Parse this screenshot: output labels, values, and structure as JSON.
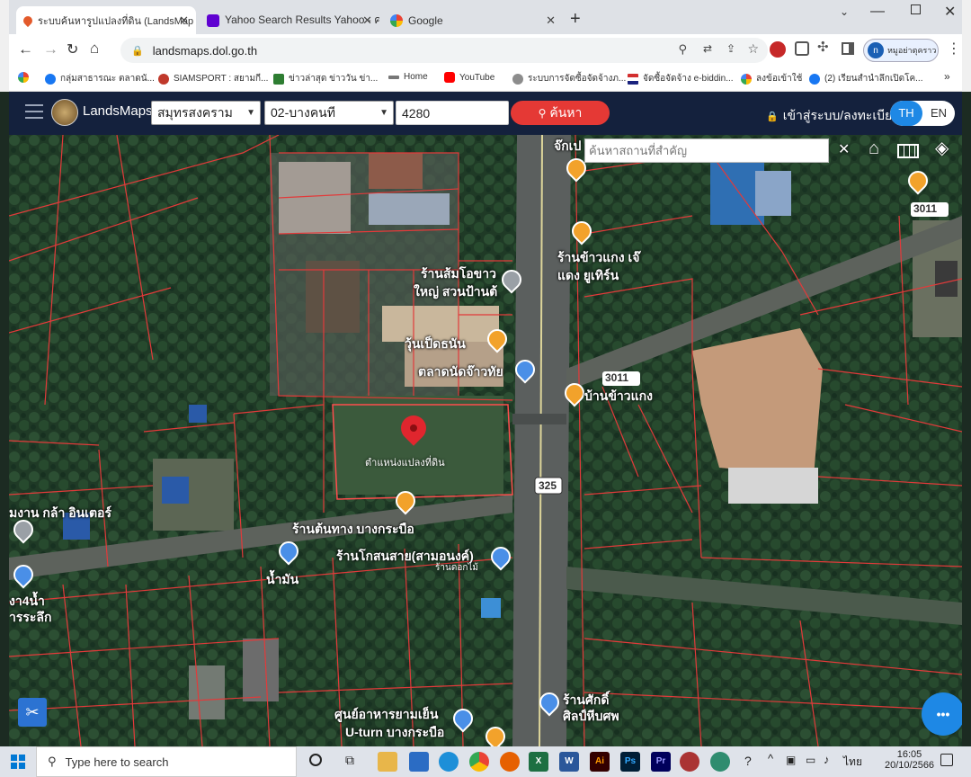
{
  "browser": {
    "tabs": [
      {
        "title": "ระบบค้นหารูปแปลงที่ดิน (LandsMap",
        "active": true
      },
      {
        "title": "Yahoo Search Results Yahoo - ค",
        "active": false
      },
      {
        "title": "Google",
        "active": false
      }
    ],
    "new_tab": "+",
    "url": "landsmaps.dol.go.th",
    "profile": "หมูอย่าตุคราว",
    "bookmarks": [
      "กลุ่มสาธารณะ ตลาดนั...",
      "SIAMSPORT : สยามกี...",
      "ข่าวล่าสุด ข่าววัน ข่า...",
      "Home",
      "YouTube",
      "ระบบการจัดซื้อจัดจ้างภ...",
      "จัดซื้อจัดจ้าง e-biddin...",
      "ลงข้อเข้าใช้",
      "(2) เรียนสำนำลึกเปิดโค..."
    ],
    "bookmarks_more": "»"
  },
  "app": {
    "logo": "LandsMaps",
    "province": "สมุทรสงคราม",
    "district": "02-บางคนที",
    "parcel_no": "4280",
    "search_button": "ค้นหา",
    "login": "เข้าสู่ระบบ/ลงทะเบียน",
    "lang_th": "TH",
    "lang_en": "EN"
  },
  "map": {
    "search_placeholder": "ค้นหาสถานที่สำคัญ",
    "labels": {
      "top_shop": "จ๊กเป",
      "shop1": "ร้านส้มโอขาว",
      "shop1b": "ใหญ่ สวนป้านต้",
      "shop2": "ร้านข้าวแกง เจ๊",
      "shop2b": "แดง ยูเทิร์น",
      "noodle": "วุ้นเป็ดธนัน",
      "market": "ตลาดนัดจ๊าวทัย",
      "rice": "บ้านข้าวแกง",
      "parcel": "ตำแหน่งแปลงที่ดิน",
      "left1": "มงาน กล้า อินเตอร์",
      "shop3": "ร้านต้นทาง บางกระบือ",
      "shop4": "ร้านโกสนสาย(สามอนงค์)",
      "shop4b": "ร้านดอกไม้",
      "oil": "น้ำมัน",
      "left2": "งา4น้ำ",
      "left2b": "ารระลึก",
      "food": "ศูนย์อาหารยามเย็น",
      "food2": "U-turn บางกระบือ",
      "shop5": "ร้านศักดิ์",
      "shop5b": "ศิลป์หีบศพ",
      "road1": "3011",
      "road2": "3011",
      "road3": "325"
    },
    "fab": "•••"
  },
  "taskbar": {
    "search": "Type here to search",
    "lang": "ไทย",
    "time": "16:05",
    "date": "20/10/2566"
  }
}
